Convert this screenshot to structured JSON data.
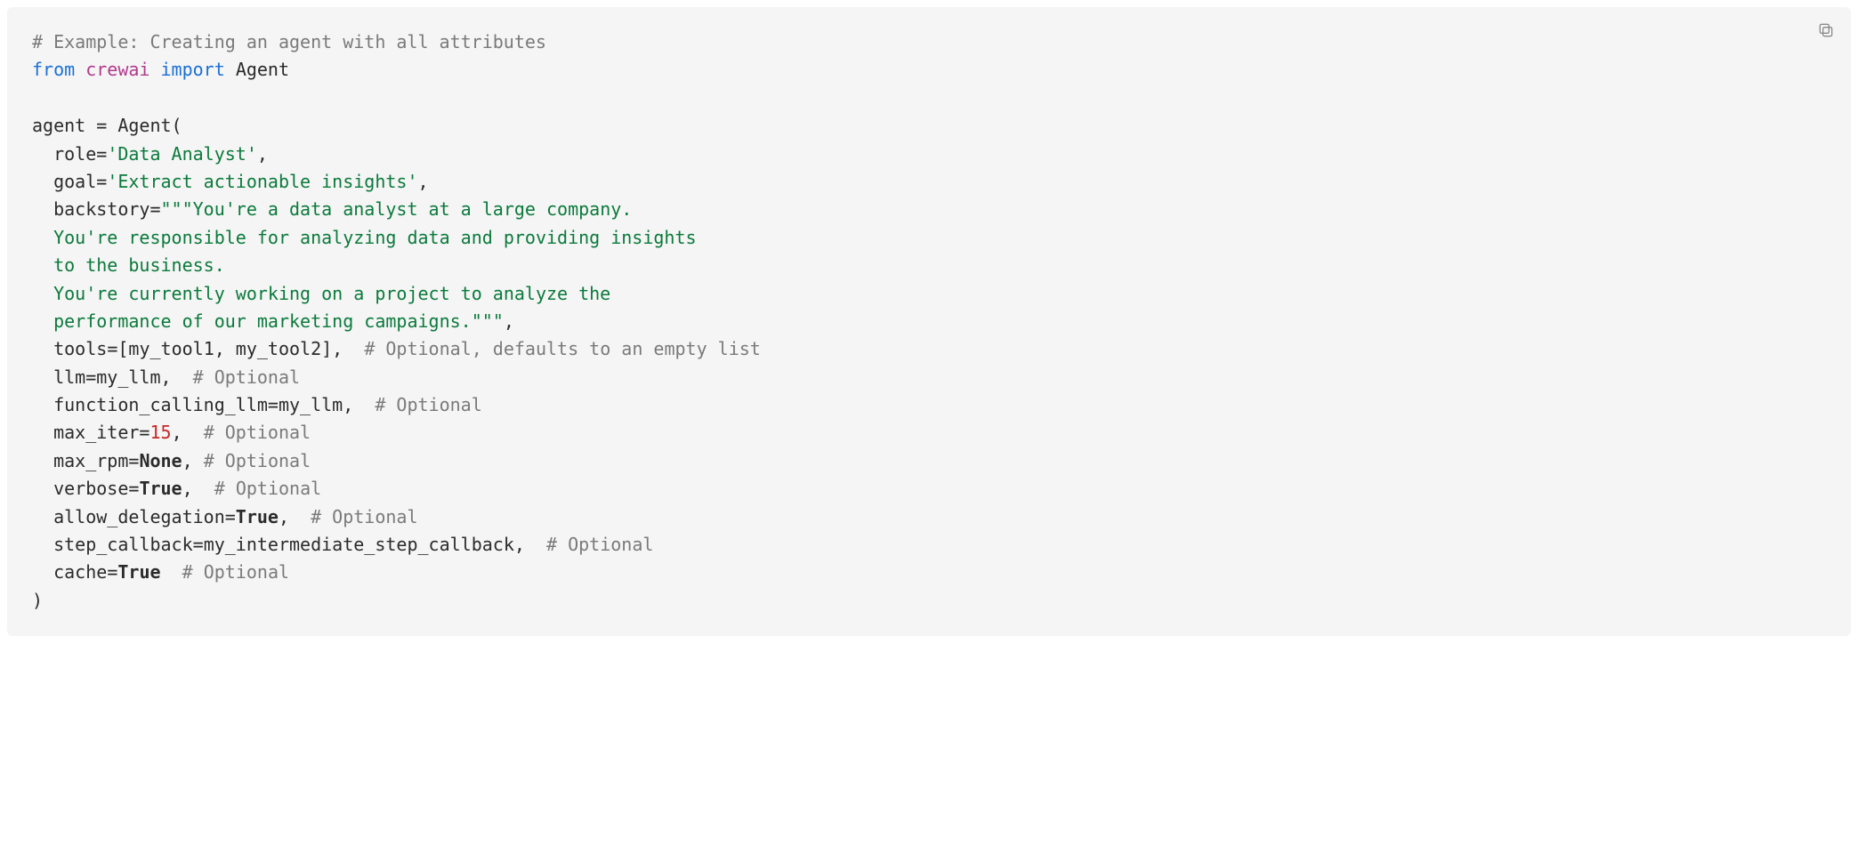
{
  "code": {
    "line1": {
      "comment": "# Example: Creating an agent with all attributes"
    },
    "line2": {
      "kw_from": "from",
      "module": "crewai",
      "kw_import": "import",
      "name": "Agent"
    },
    "line3": {
      "blank": ""
    },
    "line4": {
      "lhs": "agent ",
      "op": "=",
      "rhs": " Agent",
      "paren": "("
    },
    "line5": {
      "indent": "  ",
      "param": "role",
      "op": "=",
      "str": "'Data Analyst'",
      "comma": ","
    },
    "line6": {
      "indent": "  ",
      "param": "goal",
      "op": "=",
      "str": "'Extract actionable insights'",
      "comma": ","
    },
    "line7": {
      "indent": "  ",
      "param": "backstory",
      "op": "=",
      "str": "\"\"\"You're a data analyst at a large company."
    },
    "line8": {
      "indent": "  ",
      "str": "You're responsible for analyzing data and providing insights"
    },
    "line9": {
      "indent": "  ",
      "str": "to the business."
    },
    "line10": {
      "indent": "  ",
      "str": "You're currently working on a project to analyze the"
    },
    "line11": {
      "indent": "  ",
      "str": "performance of our marketing campaigns.\"\"\"",
      "comma": ","
    },
    "line12": {
      "indent": "  ",
      "param": "tools",
      "op": "=",
      "val": "[my_tool1, my_tool2],  ",
      "comment": "# Optional, defaults to an empty list"
    },
    "line13": {
      "indent": "  ",
      "param": "llm",
      "op": "=",
      "val": "my_llm,  ",
      "comment": "# Optional"
    },
    "line14": {
      "indent": "  ",
      "param": "function_calling_llm",
      "op": "=",
      "val": "my_llm,  ",
      "comment": "# Optional"
    },
    "line15": {
      "indent": "  ",
      "param": "max_iter",
      "op": "=",
      "num": "15",
      "after": ",  ",
      "comment": "# Optional"
    },
    "line16": {
      "indent": "  ",
      "param": "max_rpm",
      "op": "=",
      "bold": "None",
      "after": ", ",
      "comment": "# Optional"
    },
    "line17": {
      "indent": "  ",
      "param": "verbose",
      "op": "=",
      "bold": "True",
      "after": ",  ",
      "comment": "# Optional"
    },
    "line18": {
      "indent": "  ",
      "param": "allow_delegation",
      "op": "=",
      "bold": "True",
      "after": ",  ",
      "comment": "# Optional"
    },
    "line19": {
      "indent": "  ",
      "param": "step_callback",
      "op": "=",
      "val": "my_intermediate_step_callback,  ",
      "comment": "# Optional"
    },
    "line20": {
      "indent": "  ",
      "param": "cache",
      "op": "=",
      "bold": "True",
      "after": "  ",
      "comment": "# Optional"
    },
    "line21": {
      "paren": ")"
    }
  },
  "icons": {
    "copy": "copy-icon"
  }
}
